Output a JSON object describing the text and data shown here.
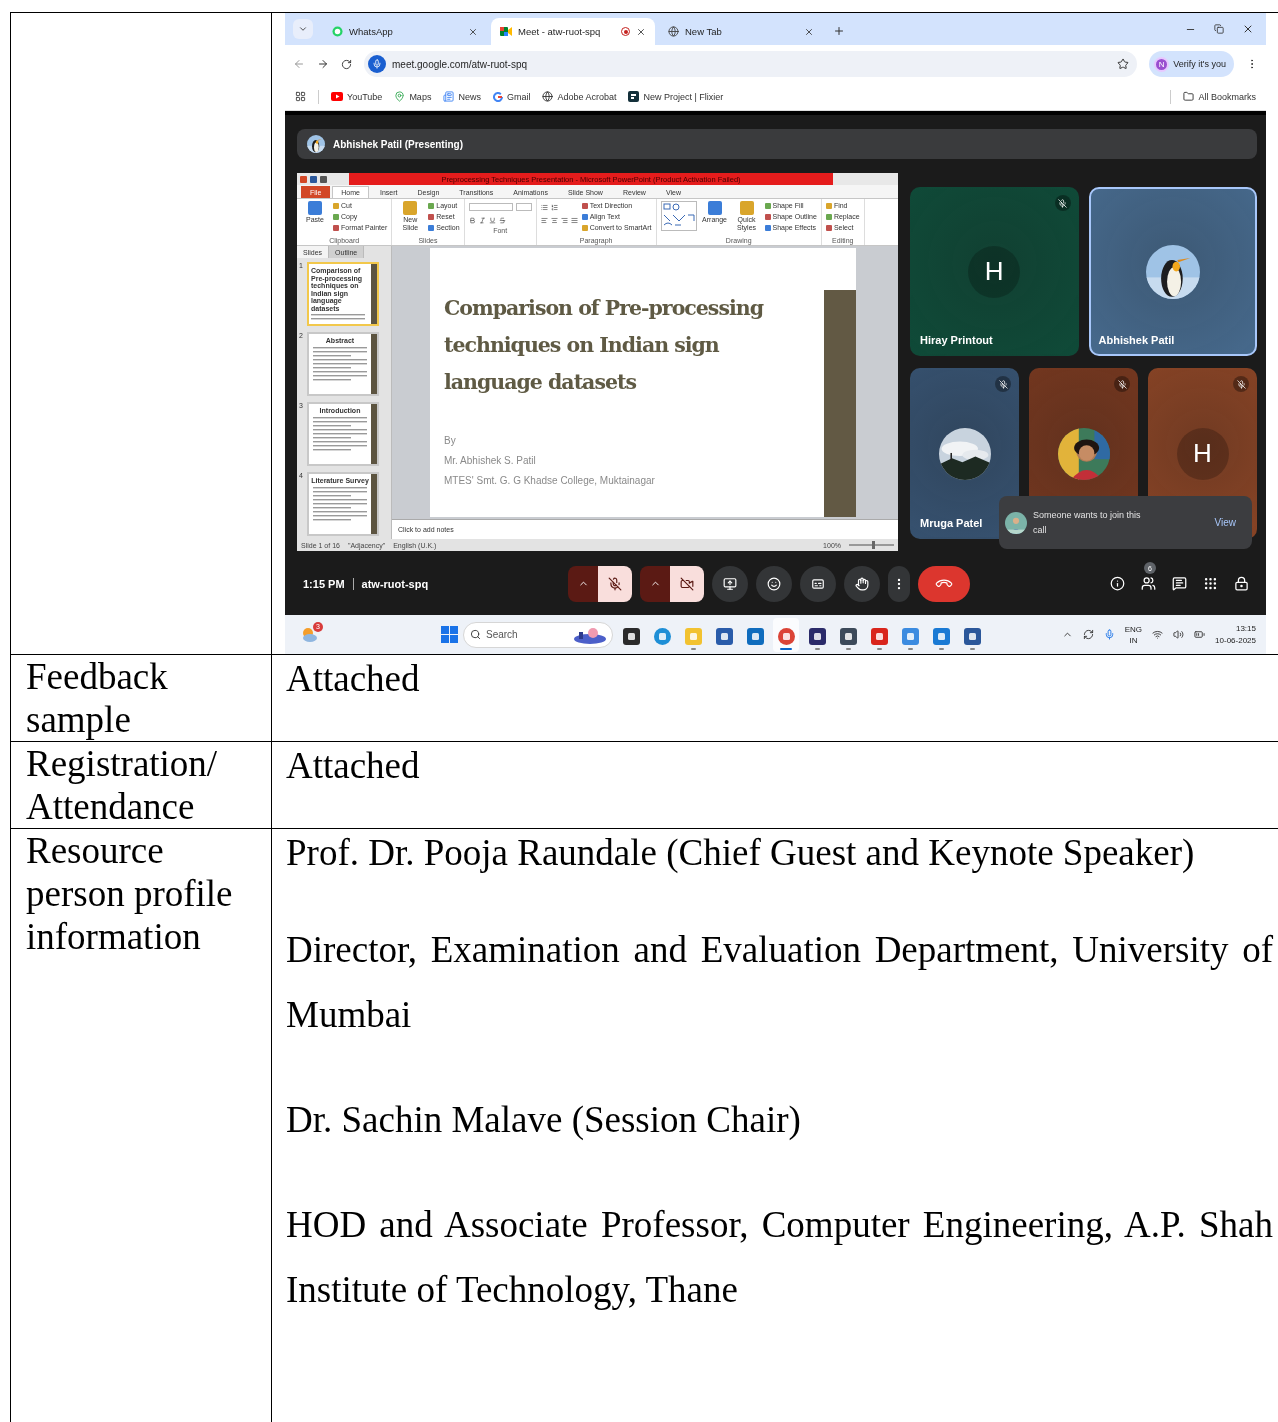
{
  "table": {
    "rows": [
      {
        "kind": "screenshot"
      },
      {
        "kind": "text",
        "label": "Feedback sample",
        "paragraphs": [
          "Attached"
        ]
      },
      {
        "kind": "text",
        "label": "Registration/ Attendance",
        "paragraphs": [
          "Attached"
        ]
      },
      {
        "kind": "text",
        "label": "Resource person profile information",
        "paragraphs": [
          "Prof. Dr. Pooja Raundale (Chief Guest and Keynote Speaker)",
          "Director, Examination and Evaluation Department, University of Mumbai",
          "Dr. Sachin Malave (Session Chair)",
          "HOD and Associate Professor, Computer Engineering, A.P. Shah Institute of Technology, Thane"
        ]
      }
    ]
  },
  "screenshot": {
    "browser": {
      "tabs": [
        {
          "kind": "chat",
          "title": "WhatsApp",
          "selected": false,
          "recording": false
        },
        {
          "kind": "meet",
          "title": "Meet - atw-ruot-spq",
          "selected": true,
          "recording": true
        },
        {
          "kind": "globe",
          "title": "New Tab",
          "selected": false,
          "recording": false
        }
      ],
      "url": "meet.google.com/atw-ruot-spq",
      "profile_initial": "N",
      "verify": "Verify it's you",
      "bookmarks": [
        {
          "kind": "video",
          "label": "YouTube"
        },
        {
          "kind": "pin",
          "label": "Maps"
        },
        {
          "kind": "newspaper",
          "label": "News"
        },
        {
          "kind": "mail",
          "label": "Gmail"
        },
        {
          "kind": "globe",
          "label": "Adobe Acrobat"
        },
        {
          "kind": "square",
          "label": "New Project | Flixier"
        }
      ],
      "all_bookmarks": "All Bookmarks"
    },
    "meet": {
      "presenter": "Abhishek Patil (Presenting)",
      "presentation": {
        "window_title": "Preprocessing Techniques Presentation - Microsoft PowerPoint (Product Activation Failed)",
        "ribbon_tabs": [
          {
            "label": "File",
            "selected": false
          },
          {
            "label": "Home",
            "selected": true
          },
          {
            "label": "Insert",
            "selected": false
          },
          {
            "label": "Design",
            "selected": false
          },
          {
            "label": "Transitions",
            "selected": false
          },
          {
            "label": "Animations",
            "selected": false
          },
          {
            "label": "Slide Show",
            "selected": false
          },
          {
            "label": "Review",
            "selected": false
          },
          {
            "label": "View",
            "selected": false
          }
        ],
        "groups": [
          {
            "kind": "buttons",
            "label": "Clipboard",
            "buttons": [
              {
                "kind": "large",
                "label": "Paste"
              },
              {
                "kind": "small",
                "label": "Cut"
              },
              {
                "kind": "small",
                "label": "Copy"
              },
              {
                "kind": "small",
                "label": "Format Painter"
              }
            ]
          },
          {
            "kind": "buttons",
            "label": "Slides",
            "buttons": [
              {
                "kind": "large",
                "label": "New Slide"
              },
              {
                "kind": "small",
                "label": "Layout"
              },
              {
                "kind": "small",
                "label": "Reset"
              },
              {
                "kind": "small",
                "label": "Section"
              }
            ]
          },
          {
            "kind": "font",
            "label": "Font"
          },
          {
            "kind": "paragraph",
            "label": "Paragraph",
            "buttons": [
              {
                "kind": "small",
                "label": "Text Direction"
              },
              {
                "kind": "small",
                "label": "Align Text"
              },
              {
                "kind": "small",
                "label": "Convert to SmartArt"
              }
            ]
          },
          {
            "kind": "drawing",
            "label": "Drawing",
            "buttons": [
              {
                "kind": "large",
                "label": "Arrange"
              },
              {
                "kind": "large",
                "label": "Quick Styles"
              },
              {
                "kind": "small",
                "label": "Shape Fill"
              },
              {
                "kind": "small",
                "label": "Shape Outline"
              },
              {
                "kind": "small",
                "label": "Shape Effects"
              }
            ]
          },
          {
            "kind": "list",
            "label": "Editing",
            "buttons": [
              {
                "kind": "small",
                "label": "Find"
              },
              {
                "kind": "small",
                "label": "Replace"
              },
              {
                "kind": "small",
                "label": "Select"
              }
            ]
          }
        ],
        "pane_tabs": [
          {
            "label": "Slides",
            "selected": true
          },
          {
            "label": "Outline",
            "selected": false
          }
        ],
        "thumbnails": [
          {
            "number": "1",
            "heading": "Comparison of Pre-processing techniques on Indian sign language datasets",
            "selected": true
          },
          {
            "number": "2",
            "heading": "Abstract",
            "selected": false
          },
          {
            "number": "3",
            "heading": "Introduction",
            "selected": false
          },
          {
            "number": "4",
            "heading": "Literature Survey",
            "selected": false
          }
        ],
        "slide": {
          "title_lines": [
            "Comparison of Pre-processing",
            "techniques on Indian sign",
            "language datasets"
          ],
          "by": "By",
          "author": "Mr. Abhishek S. Patil",
          "college": "MTES' Smt. G. G Khadse College, Muktainagar"
        },
        "notes_placeholder": "Click to add notes",
        "status": {
          "slide": "Slide 1 of 16",
          "theme": "\"Adjacency\"",
          "language": "English (U.K.)",
          "zoom": {
            "reading": "100%",
            "level": 0.5
          }
        }
      },
      "tiles": [
        {
          "name": "Hiray Printout",
          "kind": "letter",
          "letter": "H",
          "color": "#0f4a38",
          "muted": true,
          "highlighted": false
        },
        {
          "name": "Abhishek Patil",
          "kind": "picture",
          "color": "#46698c",
          "muted": false,
          "highlighted": true
        },
        {
          "name": "Mruga Patel",
          "kind": "picture",
          "color": "#36516f",
          "muted": true,
          "highlighted": false
        },
        {
          "kind": "picture",
          "color": "#74371f",
          "muted": true,
          "highlighted": false
        },
        {
          "kind": "letter",
          "letter": "H",
          "color": "#874325",
          "muted": true,
          "highlighted": false
        }
      ],
      "toast": {
        "text": "Someone wants to join this call",
        "action": "View"
      },
      "time": "1:15 PM",
      "code": "atw-ruot-spq",
      "mic_on": false,
      "camera_on": false,
      "people_count": "6"
    },
    "taskbar": {
      "weather_badge": "3",
      "search_placeholder": "Search",
      "apps": [
        {
          "kind": "taskview",
          "running": false,
          "selected": false
        },
        {
          "kind": "edge",
          "running": false,
          "selected": false
        },
        {
          "kind": "folder",
          "running": true,
          "selected": false
        },
        {
          "kind": "store",
          "running": false,
          "selected": false
        },
        {
          "kind": "mail",
          "running": false,
          "selected": false
        },
        {
          "kind": "chrome",
          "running": true,
          "selected": true
        },
        {
          "kind": "meeting",
          "running": true,
          "selected": false
        },
        {
          "kind": "monitor",
          "running": true,
          "selected": false
        },
        {
          "kind": "pdf",
          "running": true,
          "selected": false
        },
        {
          "kind": "photos",
          "running": true,
          "selected": false
        },
        {
          "kind": "clock",
          "running": true,
          "selected": false
        },
        {
          "kind": "document",
          "running": true,
          "selected": false
        }
      ],
      "language": "ENG",
      "region": "IN",
      "time": "13:15",
      "date": "10-06-2025"
    }
  }
}
